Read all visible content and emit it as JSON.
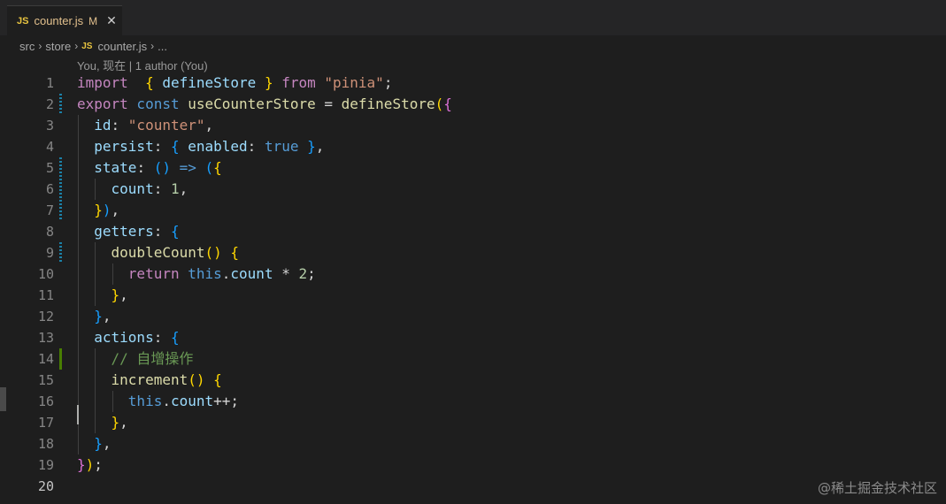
{
  "tab": {
    "lang": "JS",
    "filename": "counter.js",
    "status": "M",
    "close": "✕"
  },
  "breadcrumb": {
    "items": [
      "src",
      "store"
    ],
    "lang": "JS",
    "file": "counter.js",
    "more": "..."
  },
  "codelens": "You, 现在 | 1 author (You)",
  "lines": [
    [
      [
        "kw-ctrl",
        "import"
      ],
      [
        "",
        "  "
      ],
      [
        "b1",
        "{"
      ],
      [
        "var",
        " defineStore "
      ],
      [
        "b1",
        "}"
      ],
      [
        "kw-ctrl",
        " from "
      ],
      [
        "str",
        "\"pinia\""
      ],
      [
        "",
        ";"
      ]
    ],
    [
      [
        "kw-ctrl",
        "export"
      ],
      [
        "kw",
        " const "
      ],
      [
        "fn",
        "useCounterStore"
      ],
      [
        "",
        " = "
      ],
      [
        "fn",
        "defineStore"
      ],
      [
        "b1",
        "("
      ],
      [
        "b2",
        "{"
      ]
    ],
    [
      [
        "",
        "  "
      ],
      [
        "var",
        "id"
      ],
      [
        "",
        ": "
      ],
      [
        "str",
        "\"counter\""
      ],
      [
        "",
        ","
      ]
    ],
    [
      [
        "",
        "  "
      ],
      [
        "var",
        "persist"
      ],
      [
        "",
        ": "
      ],
      [
        "b3",
        "{"
      ],
      [
        "var",
        " enabled"
      ],
      [
        "",
        ": "
      ],
      [
        "kw",
        "true"
      ],
      [
        "b3",
        " }"
      ],
      [
        "",
        ","
      ]
    ],
    [
      [
        "",
        "  "
      ],
      [
        "var",
        "state"
      ],
      [
        "",
        ": "
      ],
      [
        "b3",
        "()"
      ],
      [
        "kw",
        " =>"
      ],
      [
        "b3",
        " ("
      ],
      [
        "b1",
        "{"
      ]
    ],
    [
      [
        "",
        "    "
      ],
      [
        "var",
        "count"
      ],
      [
        "",
        ": "
      ],
      [
        "num",
        "1"
      ],
      [
        "",
        ","
      ]
    ],
    [
      [
        "",
        "  "
      ],
      [
        "b1",
        "}"
      ],
      [
        "b3",
        ")"
      ],
      [
        "",
        ","
      ]
    ],
    [
      [
        "",
        "  "
      ],
      [
        "var",
        "getters"
      ],
      [
        "",
        ": "
      ],
      [
        "b3",
        "{"
      ]
    ],
    [
      [
        "",
        "    "
      ],
      [
        "fn",
        "doubleCount"
      ],
      [
        "b1",
        "()"
      ],
      [
        "b1",
        " {"
      ]
    ],
    [
      [
        "",
        "      "
      ],
      [
        "kw-ctrl",
        "return"
      ],
      [
        "kw",
        " this"
      ],
      [
        "",
        "."
      ],
      [
        "var",
        "count"
      ],
      [
        "",
        " * "
      ],
      [
        "num",
        "2"
      ],
      [
        "",
        ";"
      ]
    ],
    [
      [
        "",
        "    "
      ],
      [
        "b1",
        "}"
      ],
      [
        "",
        ","
      ]
    ],
    [
      [
        "",
        "  "
      ],
      [
        "b3",
        "}"
      ],
      [
        "",
        ","
      ]
    ],
    [
      [
        "",
        "  "
      ],
      [
        "var",
        "actions"
      ],
      [
        "",
        ": "
      ],
      [
        "b3",
        "{"
      ]
    ],
    [
      [
        "",
        "    "
      ],
      [
        "cmt",
        "// 自增操作"
      ]
    ],
    [
      [
        "",
        "    "
      ],
      [
        "fn",
        "increment"
      ],
      [
        "b1",
        "()"
      ],
      [
        "b1",
        " {"
      ]
    ],
    [
      [
        "",
        "      "
      ],
      [
        "kw",
        "this"
      ],
      [
        "",
        "."
      ],
      [
        "var",
        "count"
      ],
      [
        "",
        "++;"
      ]
    ],
    [
      [
        "",
        "    "
      ],
      [
        "b1",
        "}"
      ],
      [
        "",
        ","
      ]
    ],
    [
      [
        "",
        "  "
      ],
      [
        "b3",
        "}"
      ],
      [
        "",
        ","
      ]
    ],
    [
      [
        "b2",
        "}"
      ],
      [
        "b1",
        ")"
      ],
      [
        "",
        ";"
      ]
    ],
    [
      [
        "",
        ""
      ]
    ]
  ],
  "markers": [
    "",
    "mod",
    "",
    "",
    "mod",
    "mod",
    "mod",
    "",
    "mod",
    "",
    "",
    "",
    "",
    "add",
    "",
    "",
    "",
    "",
    "",
    ""
  ],
  "active_line": 20,
  "watermark": "@稀土掘金技术社区"
}
